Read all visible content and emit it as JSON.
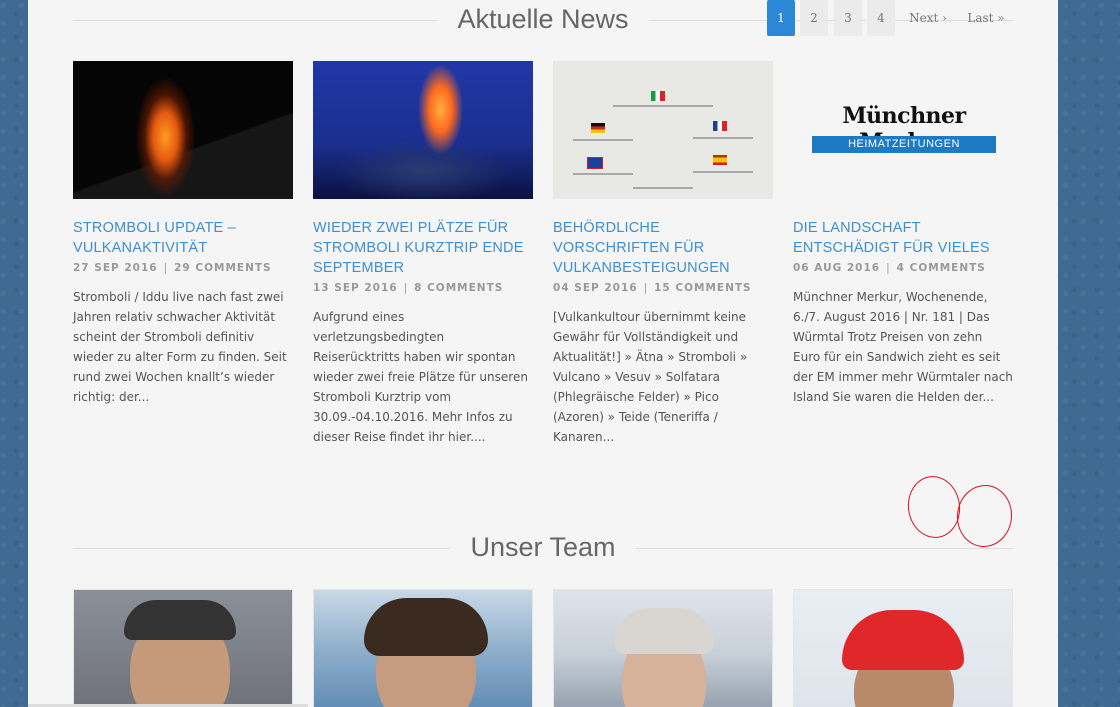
{
  "sections": {
    "news_title": "Aktuelle News",
    "team_title": "Unser Team"
  },
  "posts": [
    {
      "title": "STROMBOLI UPDATE – VULKANAKTIVITÄT",
      "date": "27 SEP 2016",
      "comments": "29 COMMENTS",
      "excerpt": "Stromboli / Iddu live nach fast zwei Jahren relativ schwacher Aktivität scheint der Stromboli definitiv wieder zu alter Form zu finden. Seit rund zwei Wochen knallt’s wieder richtig: der..."
    },
    {
      "title": "WIEDER ZWEI PLÄTZE FÜR STROMBOLI KURZTRIP ENDE SEPTEMBER",
      "date": "13 SEP 2016",
      "comments": "8 COMMENTS",
      "excerpt": "Aufgrund eines verletzungsbedingten Reiserücktritts haben wir spontan wieder zwei freie Plätze für unseren Stromboli Kurztrip vom 30.09.-04.10.2016. Mehr Infos zu dieser Reise findet ihr hier...."
    },
    {
      "title": "BEHÖRDLICHE VORSCHRIFTEN FÜR VULKANBESTEIGUNGEN",
      "date": "04 SEP 2016",
      "comments": "15 COMMENTS",
      "excerpt": "[Vulkankultour übernimmt keine Gewähr für Vollständigkeit und Aktualität!] » Ätna » Stromboli » Vulcano » Vesuv » Solfatara (Phlegräische Felder) » Pico (Azoren) » Teide (Teneriffa / Kanaren..."
    },
    {
      "title": "DIE LANDSCHAFT ENTSCHÄDIGT FÜR VIELES",
      "date": "06 AUG 2016",
      "comments": "4 COMMENTS",
      "excerpt": "Münchner Merkur, Wochenende, 6./7. August 2016 | Nr. 181 | Das Würmtal Trotz Preisen von zehn Euro für ein Sandwich zieht es seit der EM immer mehr Würmtaler nach Island Sie waren die Helden der..."
    }
  ],
  "thumbnail_logo": {
    "name": "Münchner Merkur",
    "band": "HEIMATZEITUNGEN"
  },
  "pagination": {
    "pages": [
      "1",
      "2",
      "3",
      "4"
    ],
    "active": "1",
    "next": "Next ›",
    "last": "Last »"
  },
  "annotations": {
    "circle_color": "#e0101e"
  },
  "colors": {
    "accent": "#2c87d6",
    "link": "#3d8fd1",
    "background": "#3f6a92"
  }
}
